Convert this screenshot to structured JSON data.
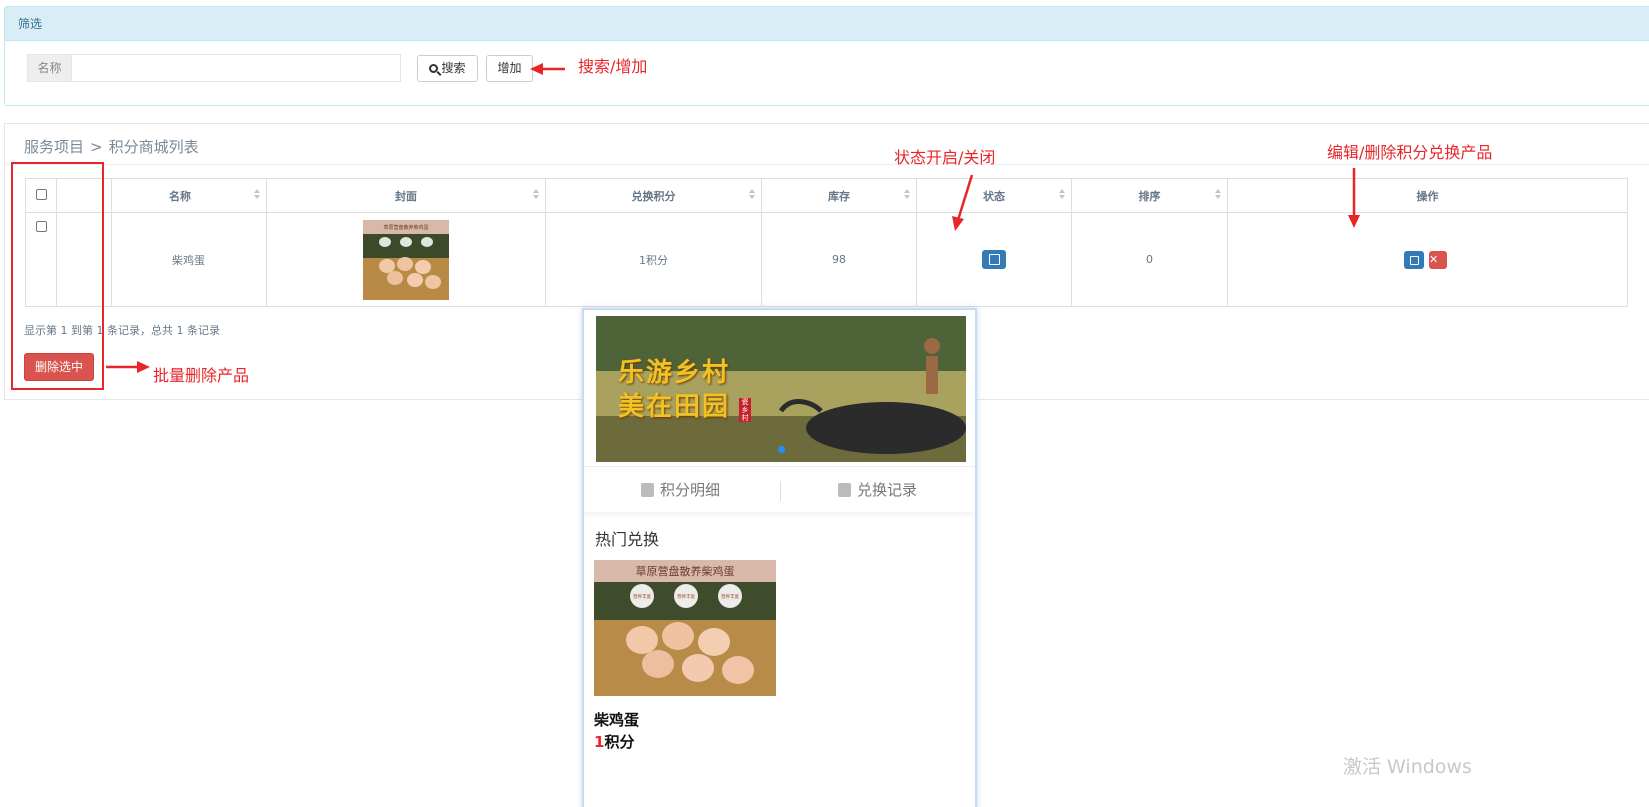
{
  "filter": {
    "header": "筛选",
    "name_label": "名称",
    "name_value": "",
    "search_label": "搜索",
    "add_label": "增加"
  },
  "breadcrumb": {
    "section": "服务项目",
    "separator": ">",
    "page": "积分商城列表"
  },
  "table": {
    "columns": [
      "名称",
      "封面",
      "兑换积分",
      "库存",
      "状态",
      "排序",
      "操作"
    ],
    "rows": [
      {
        "name": "柴鸡蛋",
        "points": "1积分",
        "stock": "98",
        "sort": "0"
      }
    ],
    "cover_text": "草原营盘散养柴鸡蛋"
  },
  "pagination": {
    "info": "显示第 1 到第 1 条记录，总共 1 条记录"
  },
  "bulk_delete_label": "删除选中",
  "annotations": {
    "search_add": "搜索/增加",
    "status_toggle": "状态开启/关闭",
    "edit_delete": "编辑/删除积分兑换产品",
    "bulk_delete": "批量删除产品",
    "color": "#e8262a"
  },
  "preview": {
    "banner_line1": "乐游乡村",
    "banner_line2": "美在田园",
    "banner_seal": "瓷乡村",
    "tab_points": "积分明细",
    "tab_records": "兑换记录",
    "hot_title": "热门兑换",
    "product_banner": "草原营盘散养柴鸡蛋",
    "product_badges": [
      "营养丰富",
      "营养丰富",
      "营养丰富"
    ],
    "product_name": "柴鸡蛋",
    "price_num": "1",
    "price_unit": "积分"
  },
  "watermark": "激活 Windows",
  "colors": {
    "primary": "#337ab7",
    "danger": "#d9534f",
    "info_bg": "#d9edf7"
  }
}
